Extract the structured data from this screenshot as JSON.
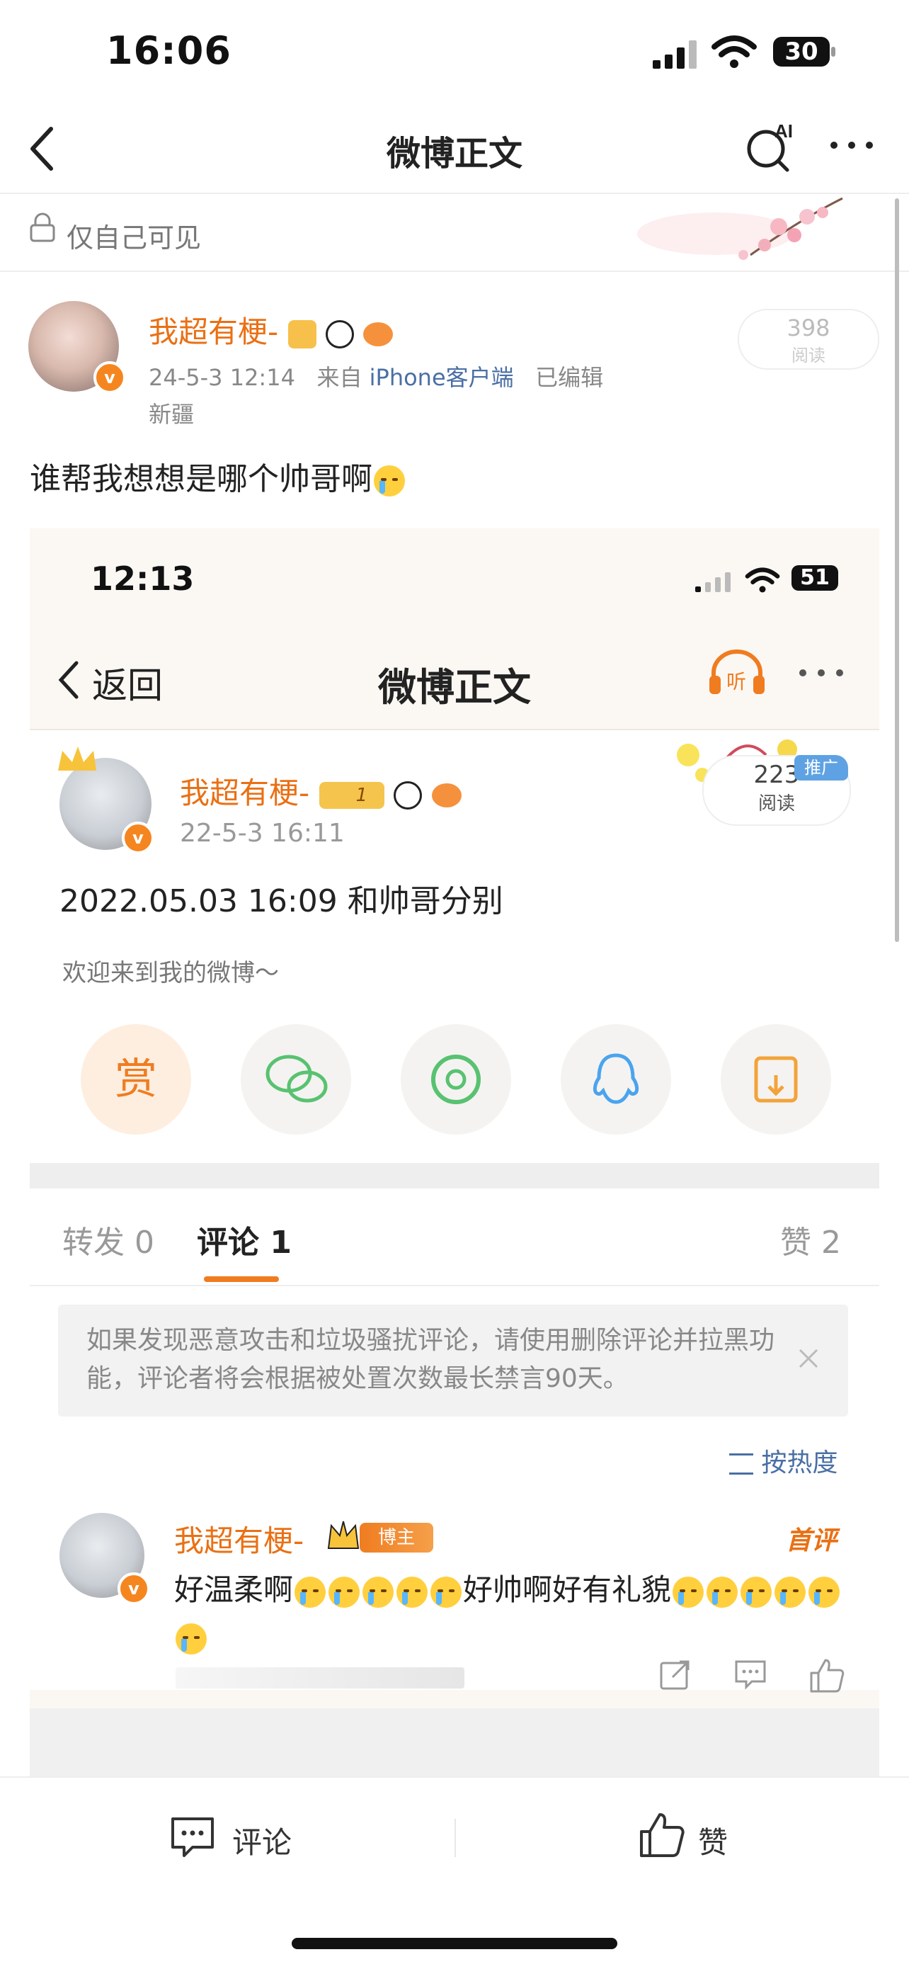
{
  "status_bar": {
    "time": "16:06",
    "battery": "30"
  },
  "nav": {
    "title": "微博正文",
    "ai_label": "AI"
  },
  "privacy": {
    "label": "仅自己可见"
  },
  "post": {
    "username": "我超有梗-",
    "date": "24-5-3 12:14",
    "source_prefix": "来自",
    "source": "iPhone客户端",
    "edited": "已编辑",
    "location": "新疆",
    "reads": "398",
    "reads_label": "阅读",
    "text": "谁帮我想想是哪个帅哥啊"
  },
  "embedded": {
    "status_time": "12:13",
    "battery": "51",
    "back_label": "返回",
    "nav_title": "微博正文",
    "listen_label": "听",
    "username": "我超有梗-",
    "level_badge": "1",
    "date": "22-5-3 16:11",
    "reads": "223",
    "reads_label": "阅读",
    "promo": "推广",
    "body": "2022.05.03 16:09 和帅哥分别",
    "welcome": "欢迎来到我的微博～",
    "reward": "赏",
    "tabs": {
      "repost_label": "转发",
      "repost_count": "0",
      "comment_label": "评论",
      "comment_count": "1",
      "like_label": "赞",
      "like_count": "2"
    },
    "notice": "如果发现恶意攻击和垃圾骚扰评论，请使用删除评论并拉黑功能，评论者将会根据被处置次数最长禁言90天。",
    "sort_label": "按热度",
    "comment": {
      "username": "我超有梗-",
      "host_badge": "博主",
      "first_badge": "首评",
      "text_a": "好温柔啊",
      "text_b": "好帅啊好有礼貌"
    }
  },
  "bottom_bar": {
    "comment_label": "评论",
    "like_label": "赞"
  },
  "colors": {
    "accent_orange": "#ea7014",
    "link_blue": "#4a6fa5",
    "promo_blue": "#5fa2e3"
  }
}
